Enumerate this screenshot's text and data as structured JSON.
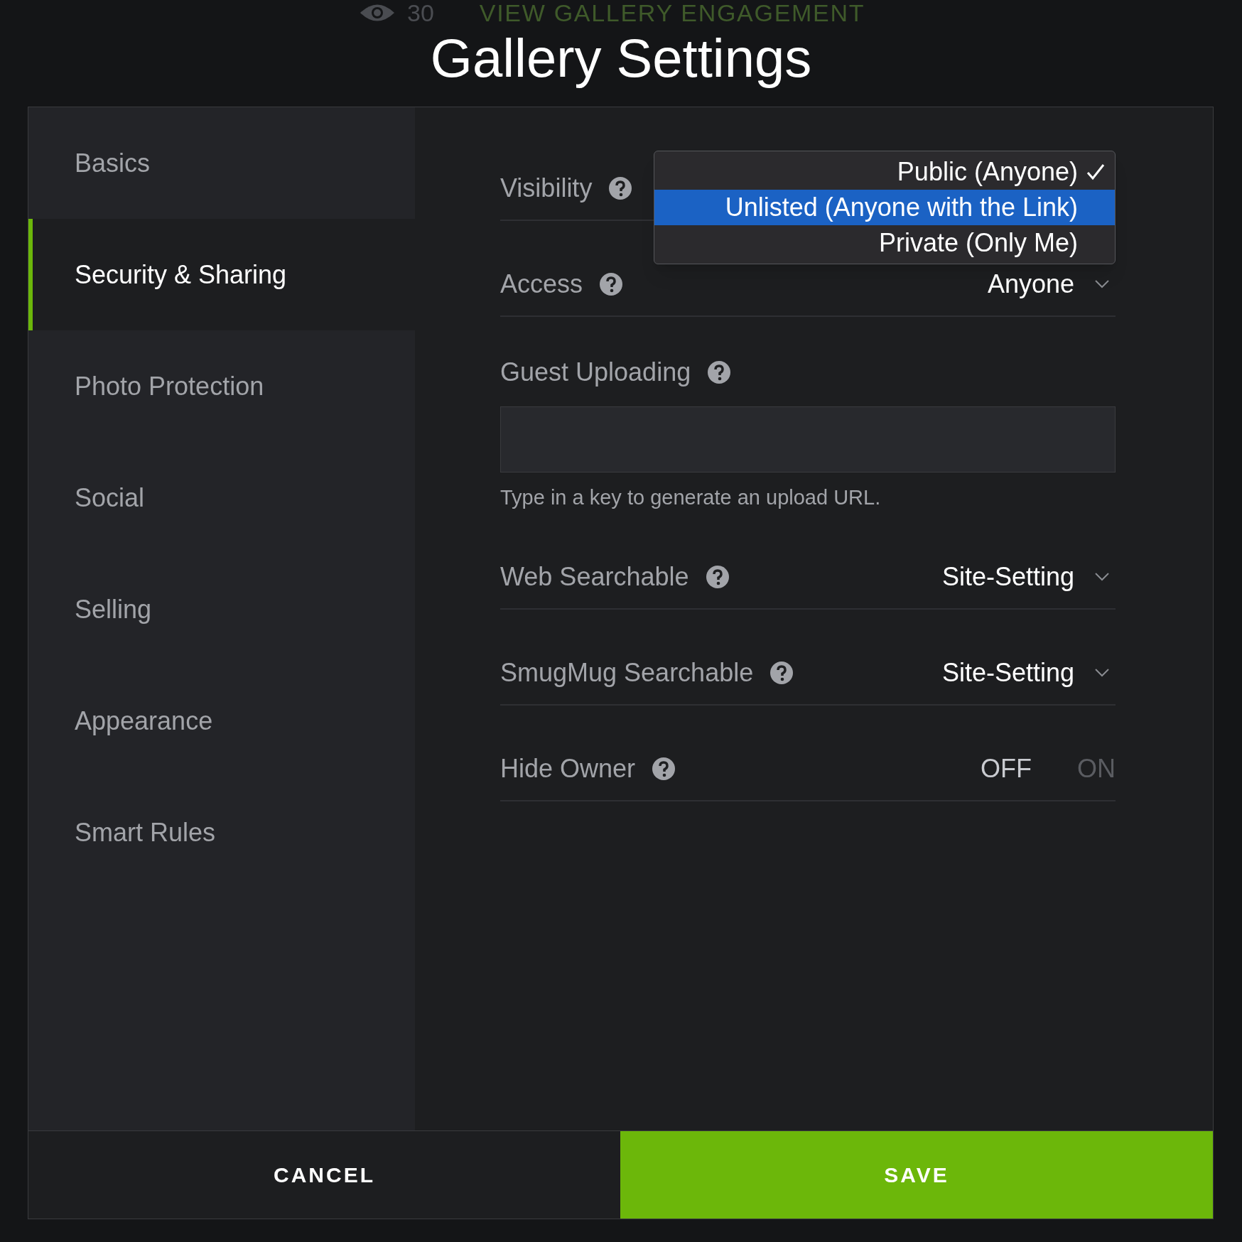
{
  "background_bar": {
    "count": "30",
    "link": "VIEW GALLERY ENGAGEMENT"
  },
  "title": "Gallery Settings",
  "sidebar": {
    "items": [
      {
        "label": "Basics",
        "selected": false
      },
      {
        "label": "Security & Sharing",
        "selected": true
      },
      {
        "label": "Photo Protection",
        "selected": false
      },
      {
        "label": "Social",
        "selected": false
      },
      {
        "label": "Selling",
        "selected": false
      },
      {
        "label": "Appearance",
        "selected": false
      },
      {
        "label": "Smart Rules",
        "selected": false
      }
    ]
  },
  "settings": [
    {
      "kind": "select",
      "label": "Visibility",
      "dropdown": {
        "options": [
          {
            "label": "Public (Anyone)",
            "checked": true,
            "selected": false
          },
          {
            "label": "Unlisted (Anyone with the Link)",
            "checked": false,
            "selected": true
          },
          {
            "label": "Private (Only Me)",
            "checked": false,
            "selected": false
          }
        ]
      }
    },
    {
      "kind": "select",
      "label": "Access",
      "value": "Anyone"
    },
    {
      "kind": "text",
      "label": "Guest Uploading",
      "hint": "Type in a key to generate an upload URL."
    },
    {
      "kind": "select",
      "label": "Web Searchable",
      "value": "Site-Setting"
    },
    {
      "kind": "select",
      "label": "SmugMug Searchable",
      "value": "Site-Setting"
    },
    {
      "kind": "toggle",
      "label": "Hide Owner",
      "off_label": "OFF",
      "on_label": "ON",
      "on": false
    }
  ],
  "buttons": {
    "cancel": "CANCEL",
    "save": "SAVE"
  }
}
